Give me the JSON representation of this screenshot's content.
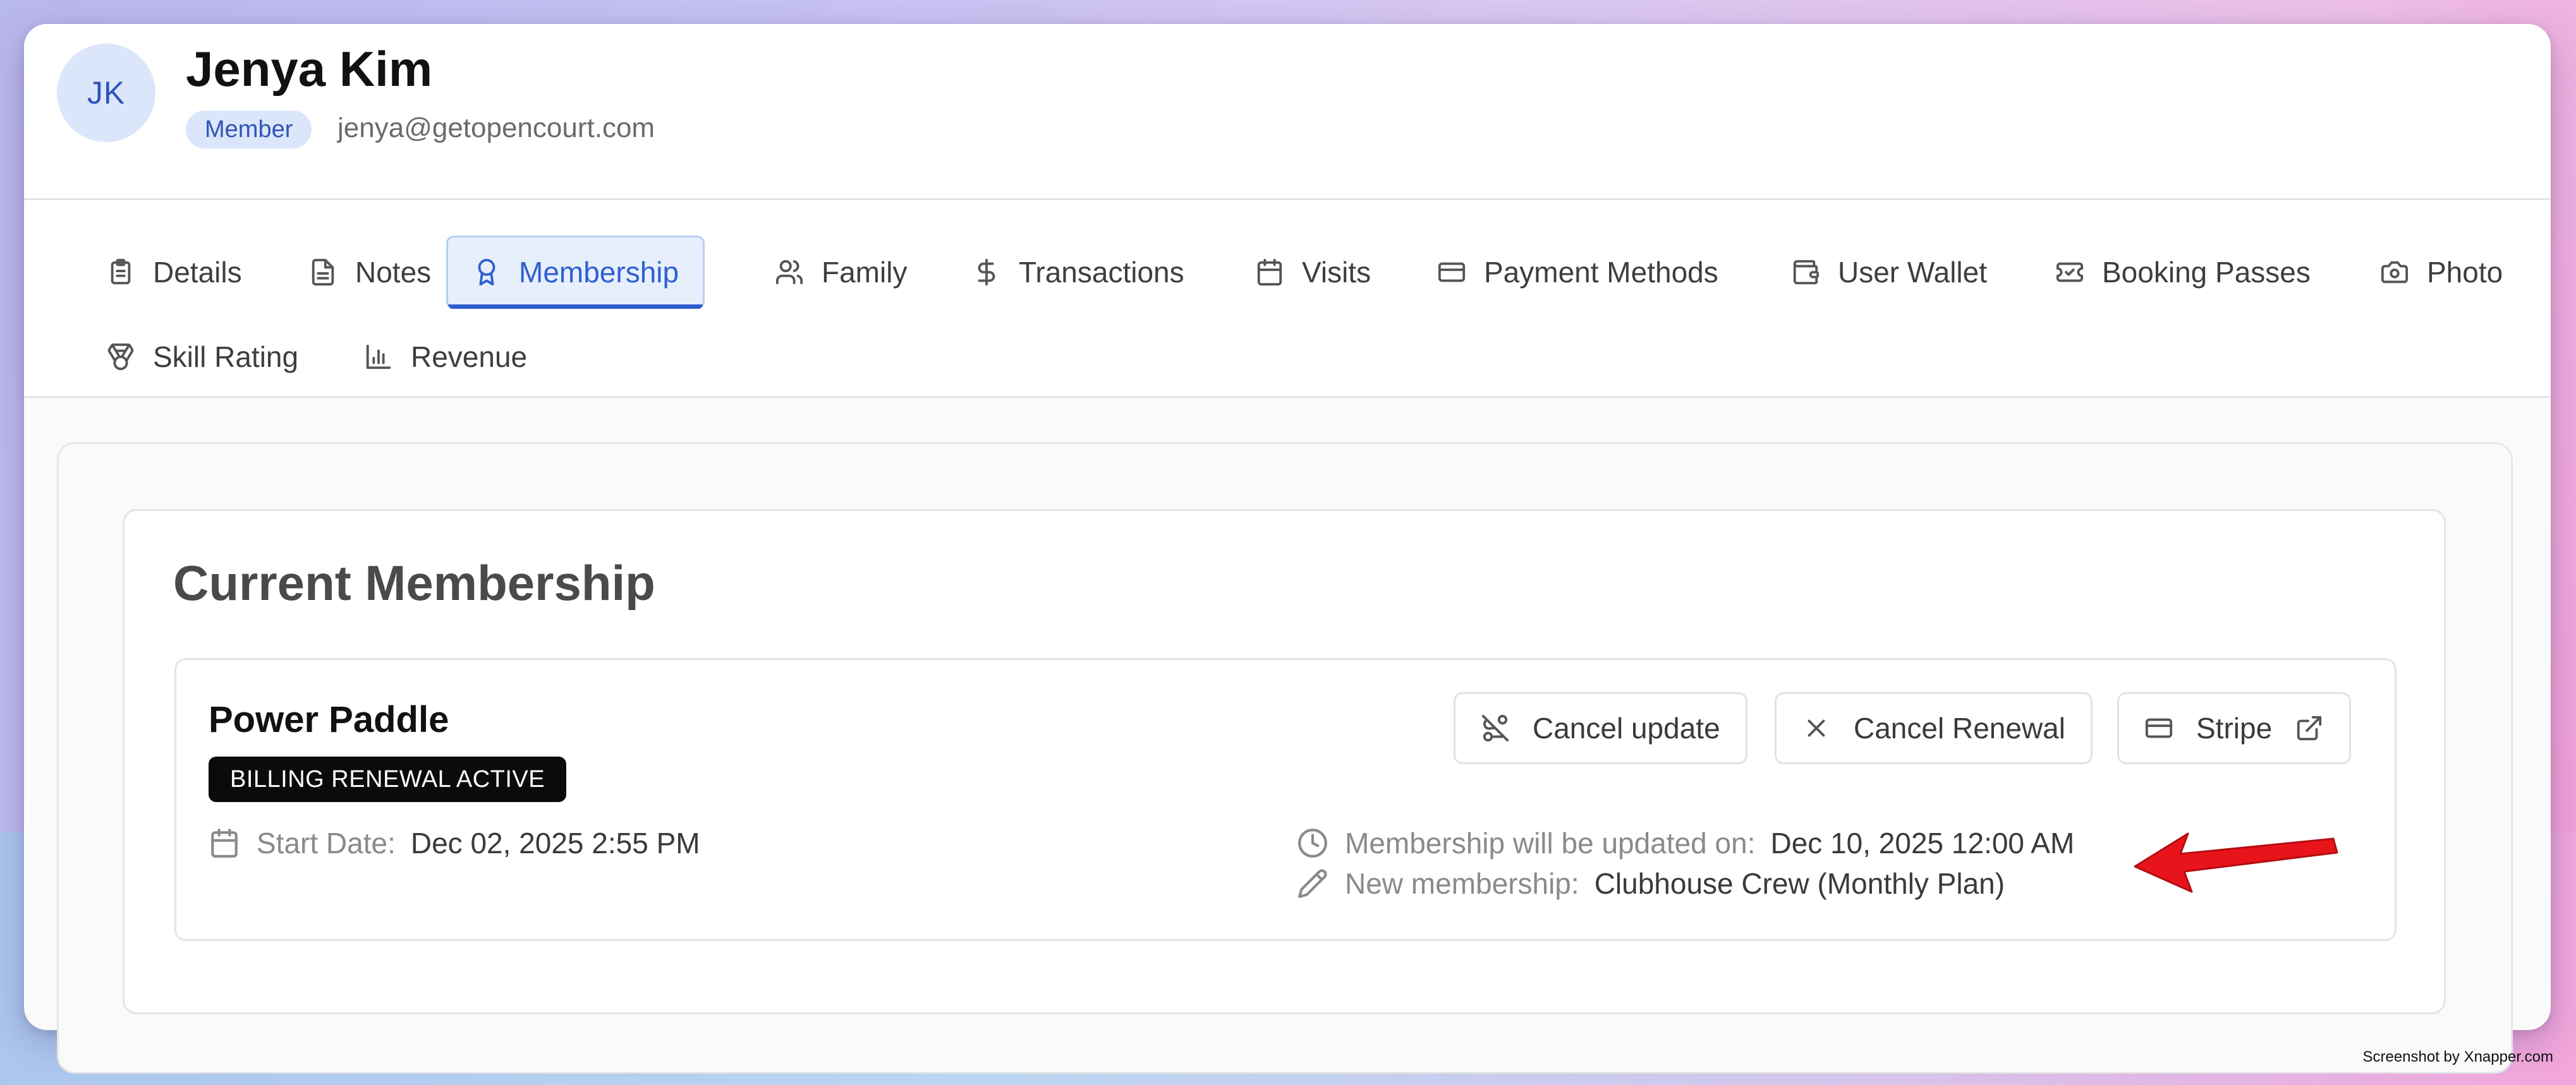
{
  "user": {
    "initials": "JK",
    "name": "Jenya Kim",
    "role": "Member",
    "email": "jenya@getopencourt.com"
  },
  "tabs": [
    {
      "label": "Details",
      "icon": "clipboard-icon"
    },
    {
      "label": "Notes",
      "icon": "document-icon"
    },
    {
      "label": "Membership",
      "icon": "award-icon",
      "active": true
    },
    {
      "label": "Family",
      "icon": "users-icon"
    },
    {
      "label": "Transactions",
      "icon": "dollar-icon"
    },
    {
      "label": "Visits",
      "icon": "calendar-icon"
    },
    {
      "label": "Payment Methods",
      "icon": "credit-card-icon"
    },
    {
      "label": "User Wallet",
      "icon": "wallet-icon"
    },
    {
      "label": "Booking Passes",
      "icon": "ticket-icon"
    },
    {
      "label": "Photo",
      "icon": "camera-icon"
    },
    {
      "label": "Skill Rating",
      "icon": "medal-icon"
    },
    {
      "label": "Revenue",
      "icon": "bar-chart-icon"
    }
  ],
  "membership": {
    "section_title": "Current Membership",
    "plan_name": "Power Paddle",
    "status": "BILLING RENEWAL ACTIVE",
    "buttons": {
      "cancel_update": "Cancel update",
      "cancel_renewal": "Cancel Renewal",
      "stripe": "Stripe"
    },
    "start_date": {
      "label": "Start Date:",
      "value": "Dec 02, 2025 2:55 PM"
    },
    "updated_on": {
      "label": "Membership will be updated on:",
      "value": "Dec 10, 2025 12:00 AM"
    },
    "new_membership": {
      "label": "New membership:",
      "value": "Clubhouse Crew (Monthly Plan)"
    }
  },
  "watermark": "Screenshot by Xnapper.com",
  "colors": {
    "accent": "#2f5fd0",
    "accent_bg": "#e7effd",
    "badge_dark": "#0b0b0b",
    "arrow": "#e8141b"
  }
}
